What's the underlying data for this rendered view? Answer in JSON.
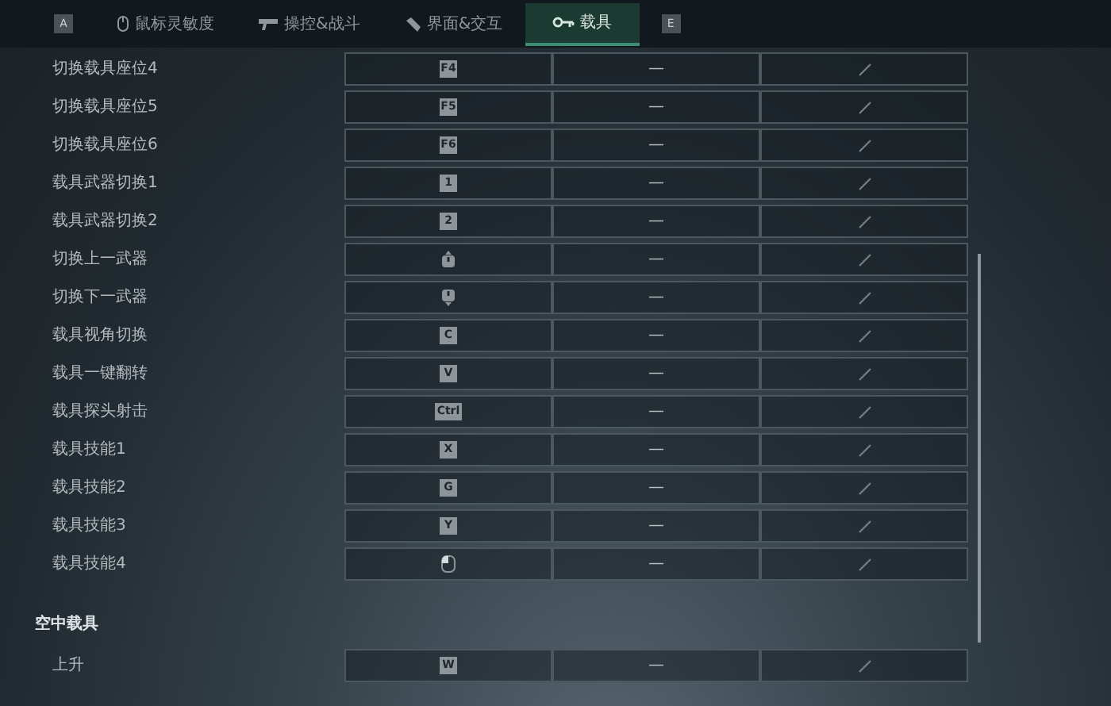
{
  "tabs": [
    {
      "kind": "hint",
      "label": "A"
    },
    {
      "kind": "tab",
      "label": "鼠标灵敏度",
      "selected": false
    },
    {
      "kind": "tab",
      "label": "操控&战斗",
      "selected": false
    },
    {
      "kind": "tab",
      "label": "界面&交互",
      "selected": false
    },
    {
      "kind": "tab",
      "label": "载具",
      "selected": true
    },
    {
      "kind": "hint",
      "label": "E"
    }
  ],
  "sections": [
    {
      "rows": [
        {
          "label": "切换载具座位4",
          "key": {
            "kind": "key",
            "label": "F4"
          },
          "secondary": "—"
        },
        {
          "label": "切换载具座位5",
          "key": {
            "kind": "key",
            "label": "F5"
          },
          "secondary": "—"
        },
        {
          "label": "切换载具座位6",
          "key": {
            "kind": "key",
            "label": "F6"
          },
          "secondary": "—"
        },
        {
          "label": "载具武器切换1",
          "key": {
            "kind": "key",
            "label": "1"
          },
          "secondary": "—"
        },
        {
          "label": "载具武器切换2",
          "key": {
            "kind": "key",
            "label": "2"
          },
          "secondary": "—"
        },
        {
          "label": "切换上一武器",
          "key": {
            "kind": "wheel_up"
          },
          "secondary": "—"
        },
        {
          "label": "切换下一武器",
          "key": {
            "kind": "wheel_down"
          },
          "secondary": "—"
        },
        {
          "label": "载具视角切换",
          "key": {
            "kind": "key",
            "label": "C"
          },
          "secondary": "—"
        },
        {
          "label": "载具一键翻转",
          "key": {
            "kind": "key",
            "label": "V"
          },
          "secondary": "—"
        },
        {
          "label": "载具探头射击",
          "key": {
            "kind": "key",
            "label": "Ctrl"
          },
          "secondary": "—"
        },
        {
          "label": "载具技能1",
          "key": {
            "kind": "key",
            "label": "X"
          },
          "secondary": "—"
        },
        {
          "label": "载具技能2",
          "key": {
            "kind": "key",
            "label": "G"
          },
          "secondary": "—"
        },
        {
          "label": "载具技能3",
          "key": {
            "kind": "key",
            "label": "Y"
          },
          "secondary": "—"
        },
        {
          "label": "载具技能4",
          "key": {
            "kind": "mouse_left"
          },
          "secondary": "—"
        }
      ]
    },
    {
      "title": "空中载具",
      "rows": [
        {
          "label": "上升",
          "key": {
            "kind": "key",
            "label": "W"
          },
          "secondary": "—"
        }
      ]
    }
  ]
}
